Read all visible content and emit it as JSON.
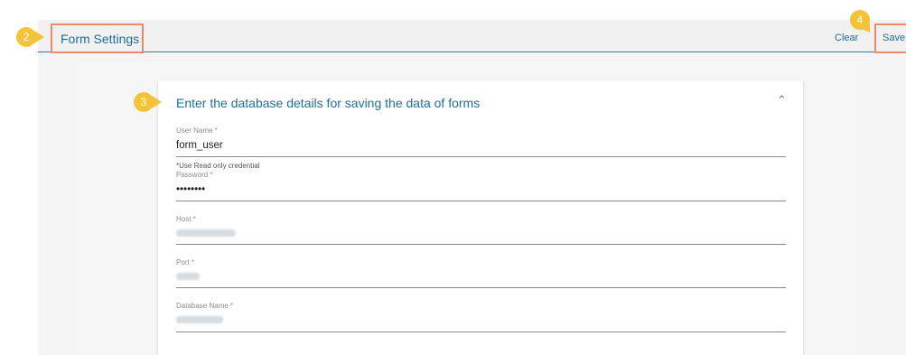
{
  "header": {
    "title": "Form Settings",
    "clear_label": "Clear",
    "save_label": "Save"
  },
  "card": {
    "title": "Enter the database details for saving the data of forms",
    "collapse_icon": "chevron-up-icon"
  },
  "form": {
    "username": {
      "label": "User Name *",
      "value": "form_user",
      "hint": "*Use Read only credential"
    },
    "password": {
      "label": "Password *",
      "value": "••••••••"
    },
    "host": {
      "label": "Host *"
    },
    "port": {
      "label": "Port *"
    },
    "database": {
      "label": "Database Name *"
    }
  },
  "annotations": {
    "badge_title": "2",
    "badge_card": "3",
    "badge_save": "4"
  },
  "colors": {
    "accent": "#1f6f99",
    "highlight_box": "#f08a6b",
    "badge": "#f3c437"
  }
}
